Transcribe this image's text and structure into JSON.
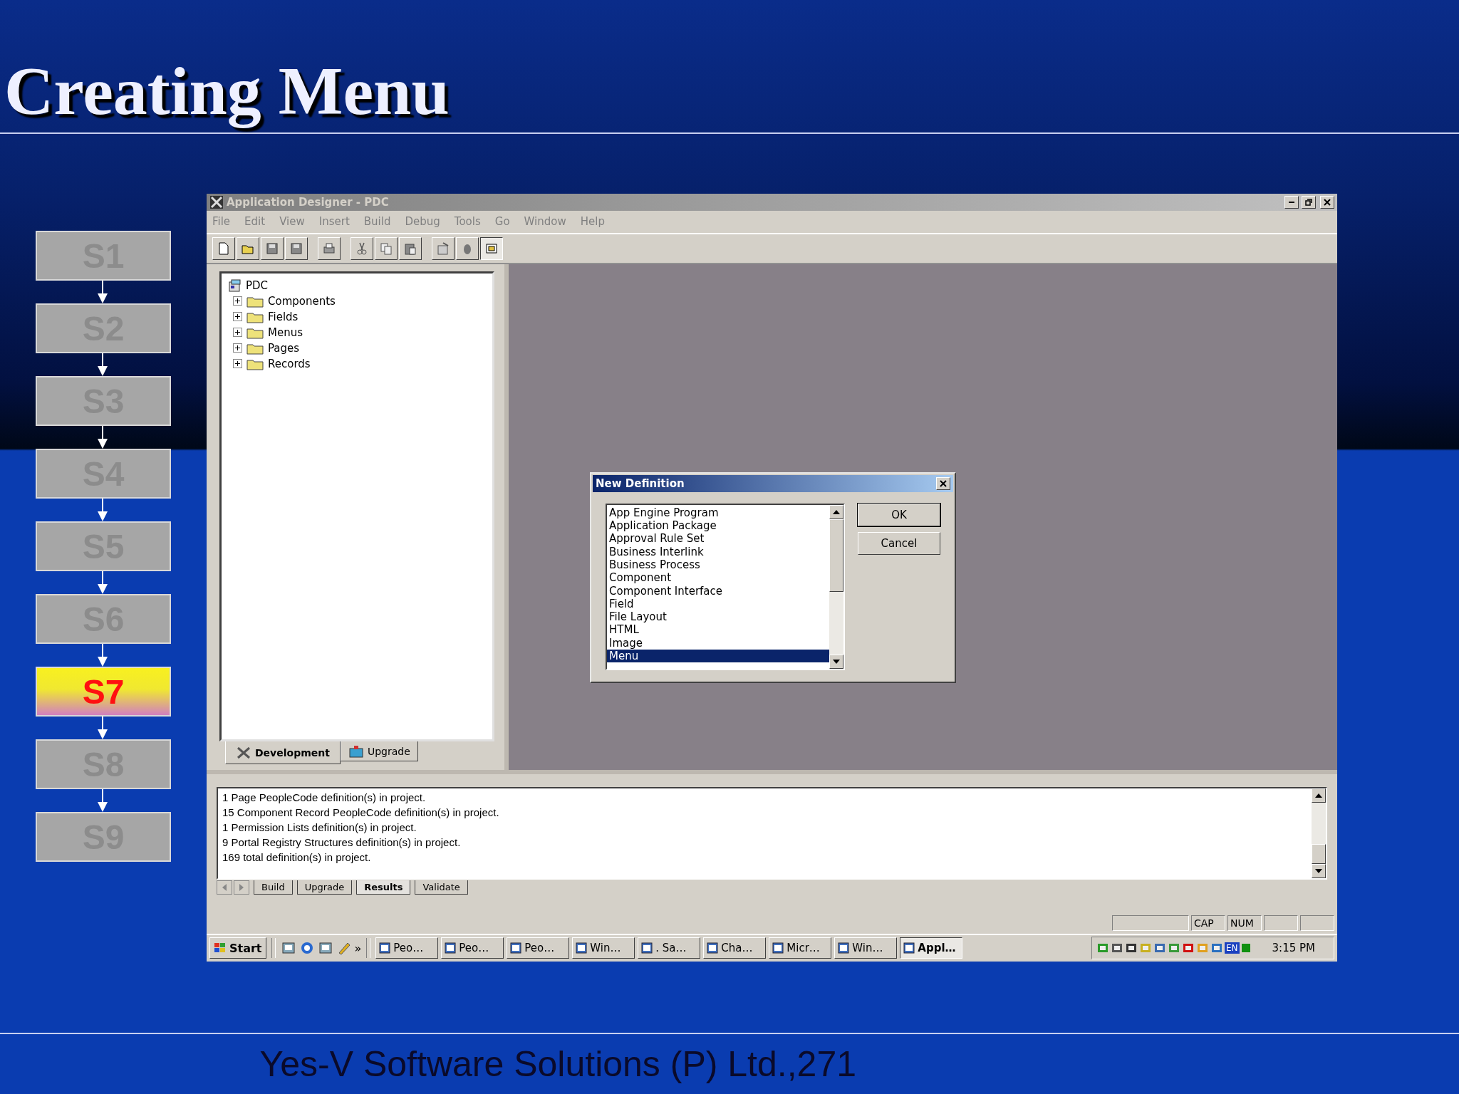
{
  "slide": {
    "title": "Creating Menu",
    "footer": "Yes-V Software Solutions (P) Ltd.,271"
  },
  "steps": [
    {
      "label": "S1",
      "selected": false
    },
    {
      "label": "S2",
      "selected": false
    },
    {
      "label": "S3",
      "selected": false
    },
    {
      "label": "S4",
      "selected": false
    },
    {
      "label": "S5",
      "selected": false
    },
    {
      "label": "S6",
      "selected": false
    },
    {
      "label": "S7",
      "selected": true
    },
    {
      "label": "S8",
      "selected": false
    },
    {
      "label": "S9",
      "selected": false
    }
  ],
  "window": {
    "title": "Application Designer - PDC"
  },
  "menu": [
    "File",
    "Edit",
    "View",
    "Insert",
    "Build",
    "Debug",
    "Tools",
    "Go",
    "Window",
    "Help"
  ],
  "tree": {
    "root": "PDC",
    "children": [
      {
        "label": "Components",
        "expanded": false
      },
      {
        "label": "Fields",
        "expanded": false
      },
      {
        "label": "Menus",
        "expanded": false
      },
      {
        "label": "Pages",
        "expanded": false
      },
      {
        "label": "Records",
        "expanded": false
      }
    ]
  },
  "project_tabs": [
    {
      "label": "Development",
      "selected": true
    },
    {
      "label": "Upgrade",
      "selected": false
    }
  ],
  "dialog": {
    "title": "New Definition",
    "items": [
      {
        "label": "App Engine Program",
        "selected": false
      },
      {
        "label": "Application Package",
        "selected": false
      },
      {
        "label": "Approval Rule Set",
        "selected": false
      },
      {
        "label": "Business Interlink",
        "selected": false
      },
      {
        "label": "Business Process",
        "selected": false
      },
      {
        "label": "Component",
        "selected": false
      },
      {
        "label": "Component Interface",
        "selected": false
      },
      {
        "label": "Field",
        "selected": false
      },
      {
        "label": "File Layout",
        "selected": false
      },
      {
        "label": "HTML",
        "selected": false
      },
      {
        "label": "Image",
        "selected": false
      },
      {
        "label": "Menu",
        "selected": true
      }
    ],
    "buttons": [
      "OK",
      "Cancel"
    ]
  },
  "output": {
    "lines": [
      "1 Page PeopleCode  definition(s) in project.",
      "15 Component Record PeopleCode  definition(s) in project.",
      "1 Permission Lists  definition(s) in project.",
      "9 Portal Registry Structures  definition(s) in project.",
      "169  total definition(s) in project."
    ],
    "tabs": [
      {
        "label": "Build",
        "selected": false
      },
      {
        "label": "Upgrade",
        "selected": false
      },
      {
        "label": "Results",
        "selected": true
      },
      {
        "label": "Validate",
        "selected": false
      }
    ]
  },
  "status_bar": [
    "CAP",
    "NUM"
  ],
  "taskbar": {
    "start": "Start",
    "more": "»",
    "tasks": [
      {
        "label": "Peo…",
        "selected": false
      },
      {
        "label": "Peo…",
        "selected": false
      },
      {
        "label": "Peo…",
        "selected": false
      },
      {
        "label": "Win…",
        "selected": false
      },
      {
        "label": ". Sa…",
        "selected": false
      },
      {
        "label": "Cha…",
        "selected": false
      },
      {
        "label": "Micr…",
        "selected": false
      },
      {
        "label": "Win…",
        "selected": false
      },
      {
        "label": "Appl…",
        "selected": true
      }
    ],
    "language": "EN",
    "clock": "3:15 PM"
  }
}
